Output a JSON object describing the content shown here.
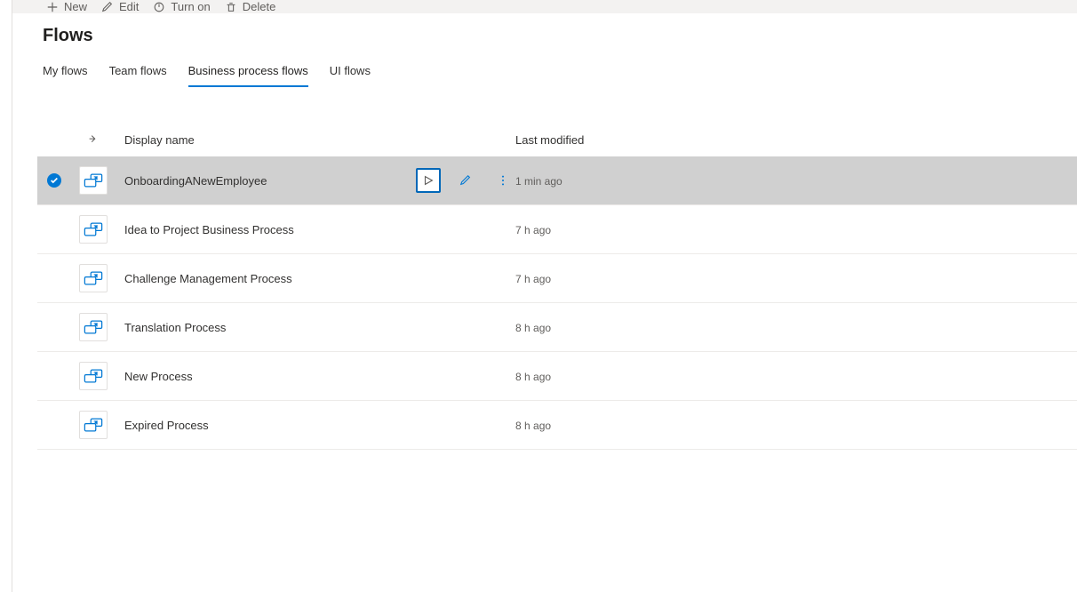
{
  "toolbar": {
    "new": "New",
    "edit": "Edit",
    "turnon": "Turn on",
    "delete": "Delete"
  },
  "page": {
    "title": "Flows"
  },
  "tabs": {
    "my": "My flows",
    "team": "Team flows",
    "bpf": "Business process flows",
    "ui": "UI flows"
  },
  "headers": {
    "name": "Display name",
    "modified": "Last modified"
  },
  "rows": [
    {
      "name": "OnboardingANewEmployee",
      "modified": "1 min ago",
      "selected": true,
      "showActions": true
    },
    {
      "name": "Idea to Project Business Process",
      "modified": "7 h ago",
      "selected": false,
      "showActions": false
    },
    {
      "name": "Challenge Management Process",
      "modified": "7 h ago",
      "selected": false,
      "showActions": false
    },
    {
      "name": "Translation Process",
      "modified": "8 h ago",
      "selected": false,
      "showActions": false
    },
    {
      "name": "New Process",
      "modified": "8 h ago",
      "selected": false,
      "showActions": false
    },
    {
      "name": "Expired Process",
      "modified": "8 h ago",
      "selected": false,
      "showActions": false
    }
  ]
}
